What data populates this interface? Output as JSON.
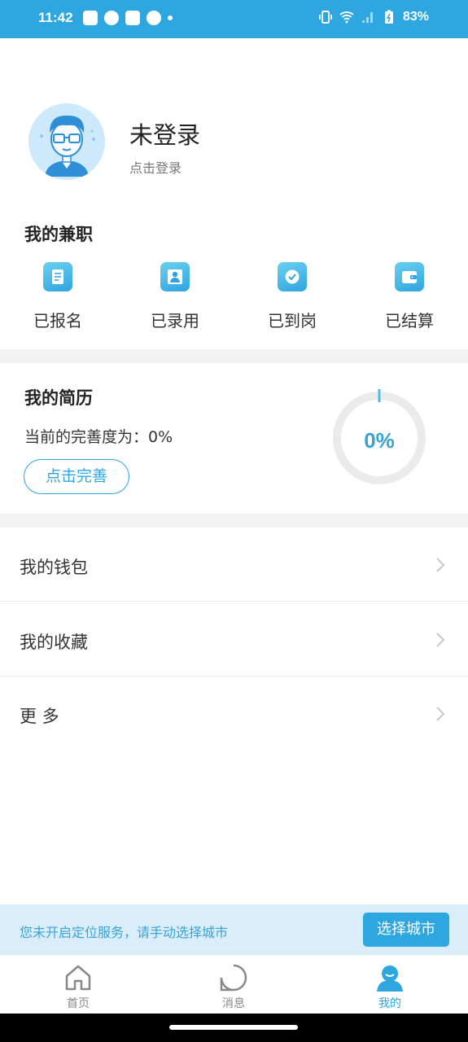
{
  "status_bar": {
    "time": "11:42",
    "battery": "83%",
    "notification_icons": [
      "bag-icon",
      "speedometer-icon",
      "bag-icon",
      "check-circle-icon",
      "dot-icon"
    ],
    "system_icons": [
      "vibrate-icon",
      "wifi-icon",
      "signal-icon",
      "battery-charging-icon"
    ]
  },
  "profile": {
    "name": "未登录",
    "action": "点击登录"
  },
  "part_time": {
    "title": "我的兼职",
    "items": [
      {
        "label": "已报名",
        "icon": "document-icon"
      },
      {
        "label": "已录用",
        "icon": "person-badge-icon"
      },
      {
        "label": "已到岗",
        "icon": "check-icon"
      },
      {
        "label": "已结算",
        "icon": "wallet-icon"
      }
    ]
  },
  "resume": {
    "title": "我的简历",
    "completion_text": "当前的完善度为：0%",
    "complete_button": "点击完善",
    "progress_label": "0%",
    "progress_percent": 0
  },
  "menu": [
    {
      "label": "我的钱包"
    },
    {
      "label": "我的收藏"
    },
    {
      "label": "更 多"
    }
  ],
  "location_banner": {
    "text": "您未开启定位服务，请手动选择城市",
    "button": "选择城市"
  },
  "tabs": [
    {
      "label": "首页",
      "icon": "home-icon",
      "active": false
    },
    {
      "label": "消息",
      "icon": "message-icon",
      "active": false
    },
    {
      "label": "我的",
      "icon": "user-icon",
      "active": true
    }
  ],
  "colors": {
    "accent": "#2ea7e0",
    "banner_bg": "#d9eef8",
    "divider": "#f3f3f3"
  }
}
